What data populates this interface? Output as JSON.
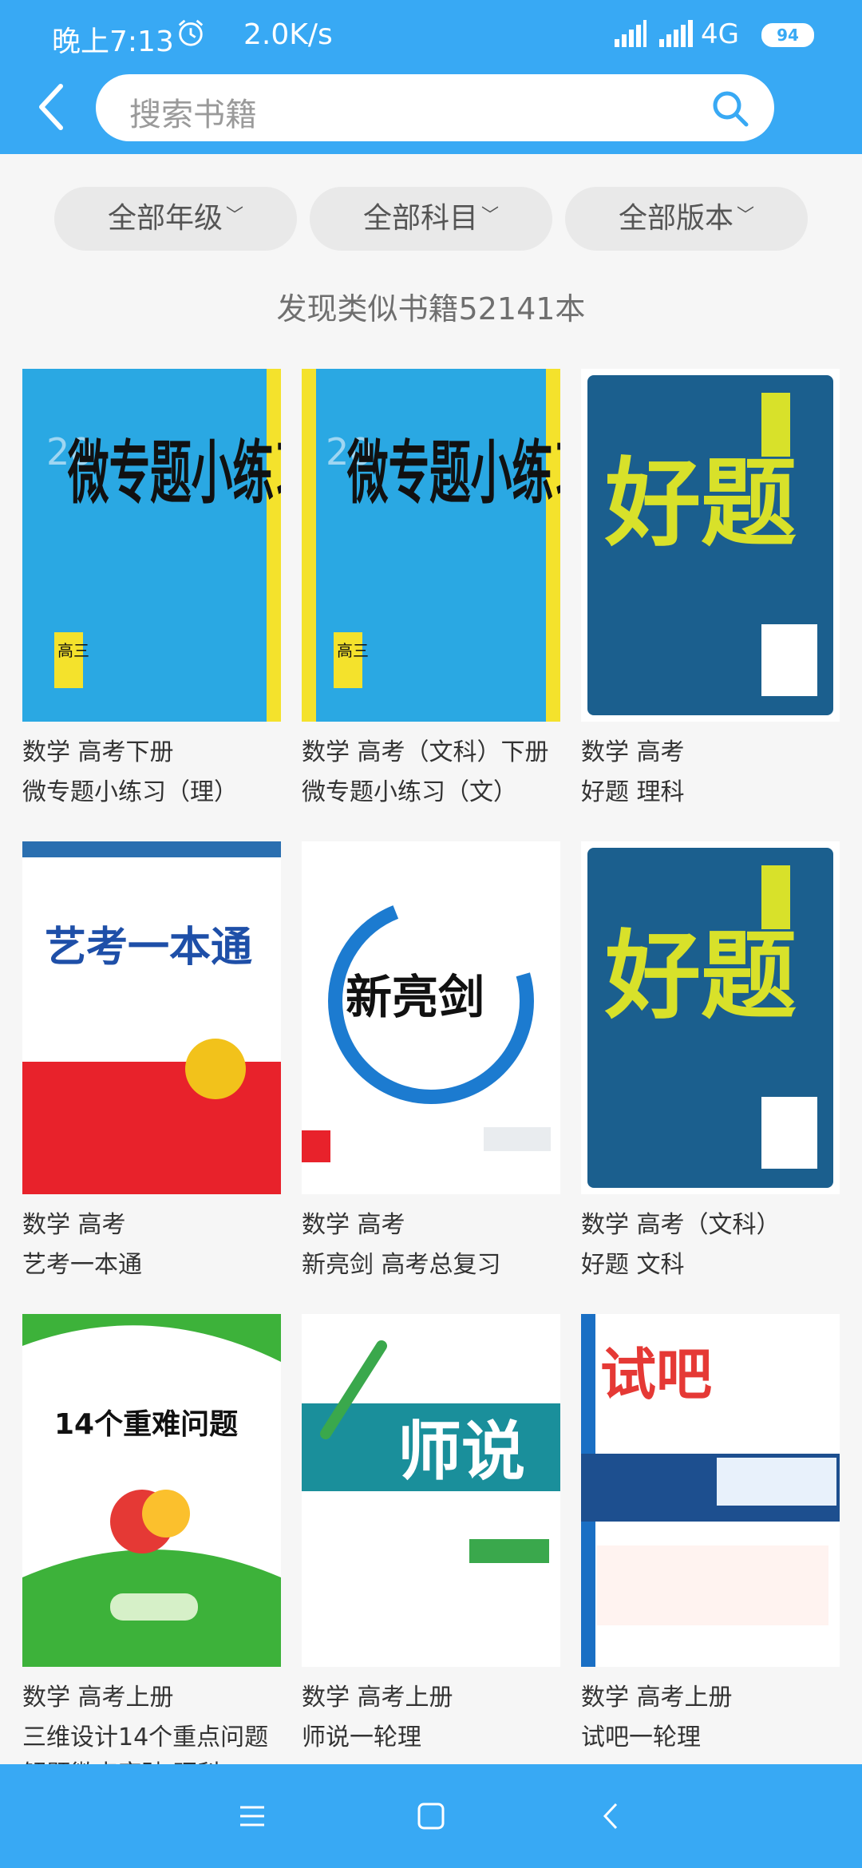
{
  "status_bar": {
    "time": "晚上7:13",
    "speed": "2.0K/s",
    "network": "4G",
    "battery": "94"
  },
  "search": {
    "placeholder": "搜索书籍"
  },
  "filters": [
    {
      "label": "全部年级"
    },
    {
      "label": "全部科目"
    },
    {
      "label": "全部版本"
    }
  ],
  "result_count_text": "发现类似书籍52141本",
  "books": [
    {
      "line1": "数学 高考下册",
      "line2": "微专题小练习（理）",
      "cover_title": "微专题小练习"
    },
    {
      "line1": "数学 高考（文科）下册",
      "line2": "微专题小练习（文）",
      "cover_title": "微专题小练习"
    },
    {
      "line1": "数学 高考",
      "line2": "好题 理科",
      "cover_title": "好题"
    },
    {
      "line1": "数学 高考",
      "line2": "艺考一本通",
      "cover_title": "艺考一本通"
    },
    {
      "line1": "数学 高考",
      "line2": "新亮剑 高考总复习",
      "cover_title": "新亮剑"
    },
    {
      "line1": "数学 高考（文科）",
      "line2": "好题 文科",
      "cover_title": "好题"
    },
    {
      "line1": "数学 高考上册",
      "line2": "三维设计14个重点问题",
      "cover_title": "14个重难问题"
    },
    {
      "line1": "数学 高考上册",
      "line2": "师说一轮理",
      "cover_title": "师说"
    },
    {
      "line1": "数学 高考上册",
      "line2": "试吧一轮理",
      "cover_title": "试吧"
    }
  ],
  "partial_text": "解题微点突破 理科",
  "colors": {
    "accent": "#38a9f4",
    "background": "#f6f6f6"
  }
}
